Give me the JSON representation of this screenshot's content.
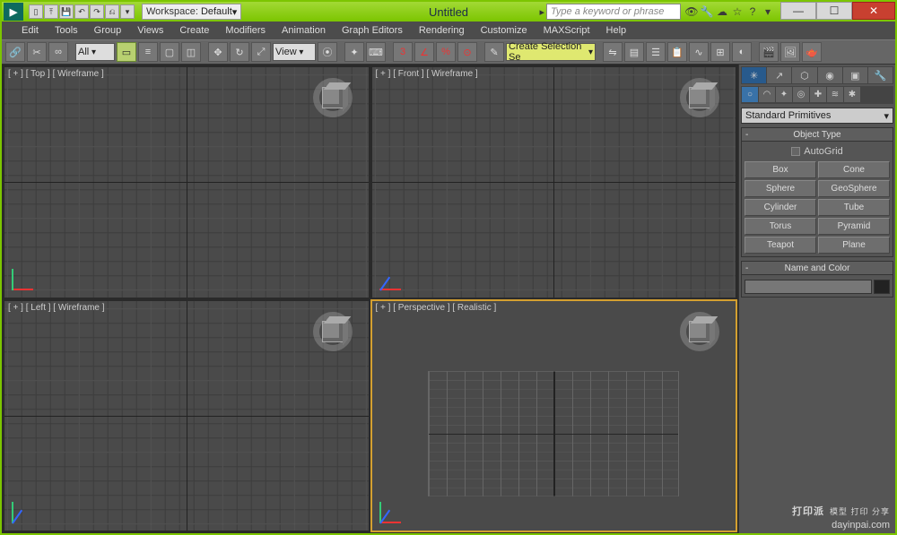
{
  "titlebar": {
    "workspace_label": "Workspace:",
    "workspace_value": "Default",
    "title": "Untitled",
    "search_placeholder": "Type a keyword or phrase"
  },
  "menu": [
    "Edit",
    "Tools",
    "Group",
    "Views",
    "Create",
    "Modifiers",
    "Animation",
    "Graph Editors",
    "Rendering",
    "Customize",
    "MAXScript",
    "Help"
  ],
  "toolbar": {
    "filter": "All",
    "view_label": "View",
    "selection_set": "Create Selection Se"
  },
  "viewports": {
    "top": "[ + ] [ Top ] [ Wireframe ]",
    "front": "[ + ] [ Front ] [ Wireframe ]",
    "left": "[ + ] [ Left ] [ Wireframe ]",
    "persp": "[ + ] [ Perspective ] [ Realistic ]"
  },
  "panel": {
    "dropdown": "Standard Primitives",
    "object_type_header": "Object Type",
    "autogrid": "AutoGrid",
    "buttons": [
      "Box",
      "Cone",
      "Sphere",
      "GeoSphere",
      "Cylinder",
      "Tube",
      "Torus",
      "Pyramid",
      "Teapot",
      "Plane"
    ],
    "name_color_header": "Name and Color"
  },
  "watermark": {
    "big": "打印派",
    "small": "模型 打印 分享",
    "url": "dayinpai.com"
  }
}
